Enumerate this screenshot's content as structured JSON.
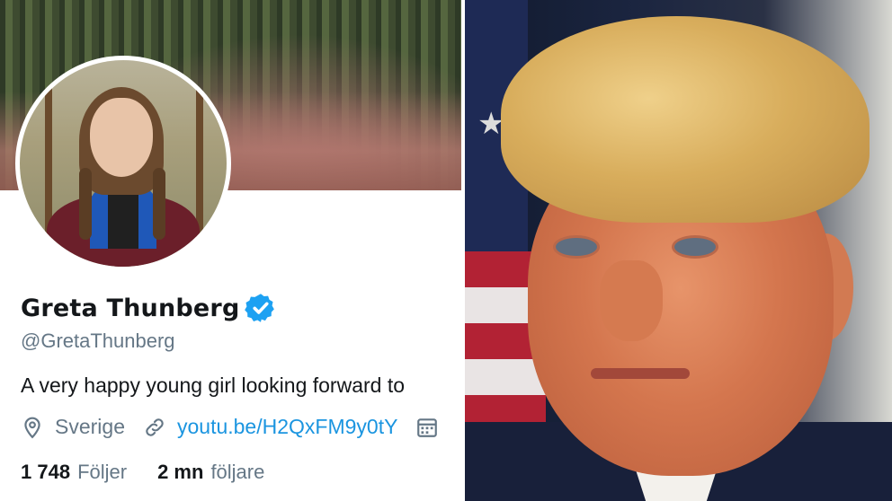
{
  "profile": {
    "name": "Greta Thunberg",
    "handle": "@GretaThunberg",
    "bio": "A very happy young girl looking forward to",
    "location": "Sverige",
    "link": "youtu.be/H2QxFM9y0tY",
    "following_count": "1 748",
    "following_label": "Följer",
    "followers_count": "2 mn",
    "followers_label": "följare"
  },
  "icons": {
    "verified": "verified-badge-icon",
    "location": "location-pin-icon",
    "link": "link-icon",
    "calendar": "calendar-icon"
  },
  "colors": {
    "name_text": "#14171a",
    "secondary_text": "#657786",
    "link": "#1b95e0",
    "verified": "#1da1f2"
  }
}
